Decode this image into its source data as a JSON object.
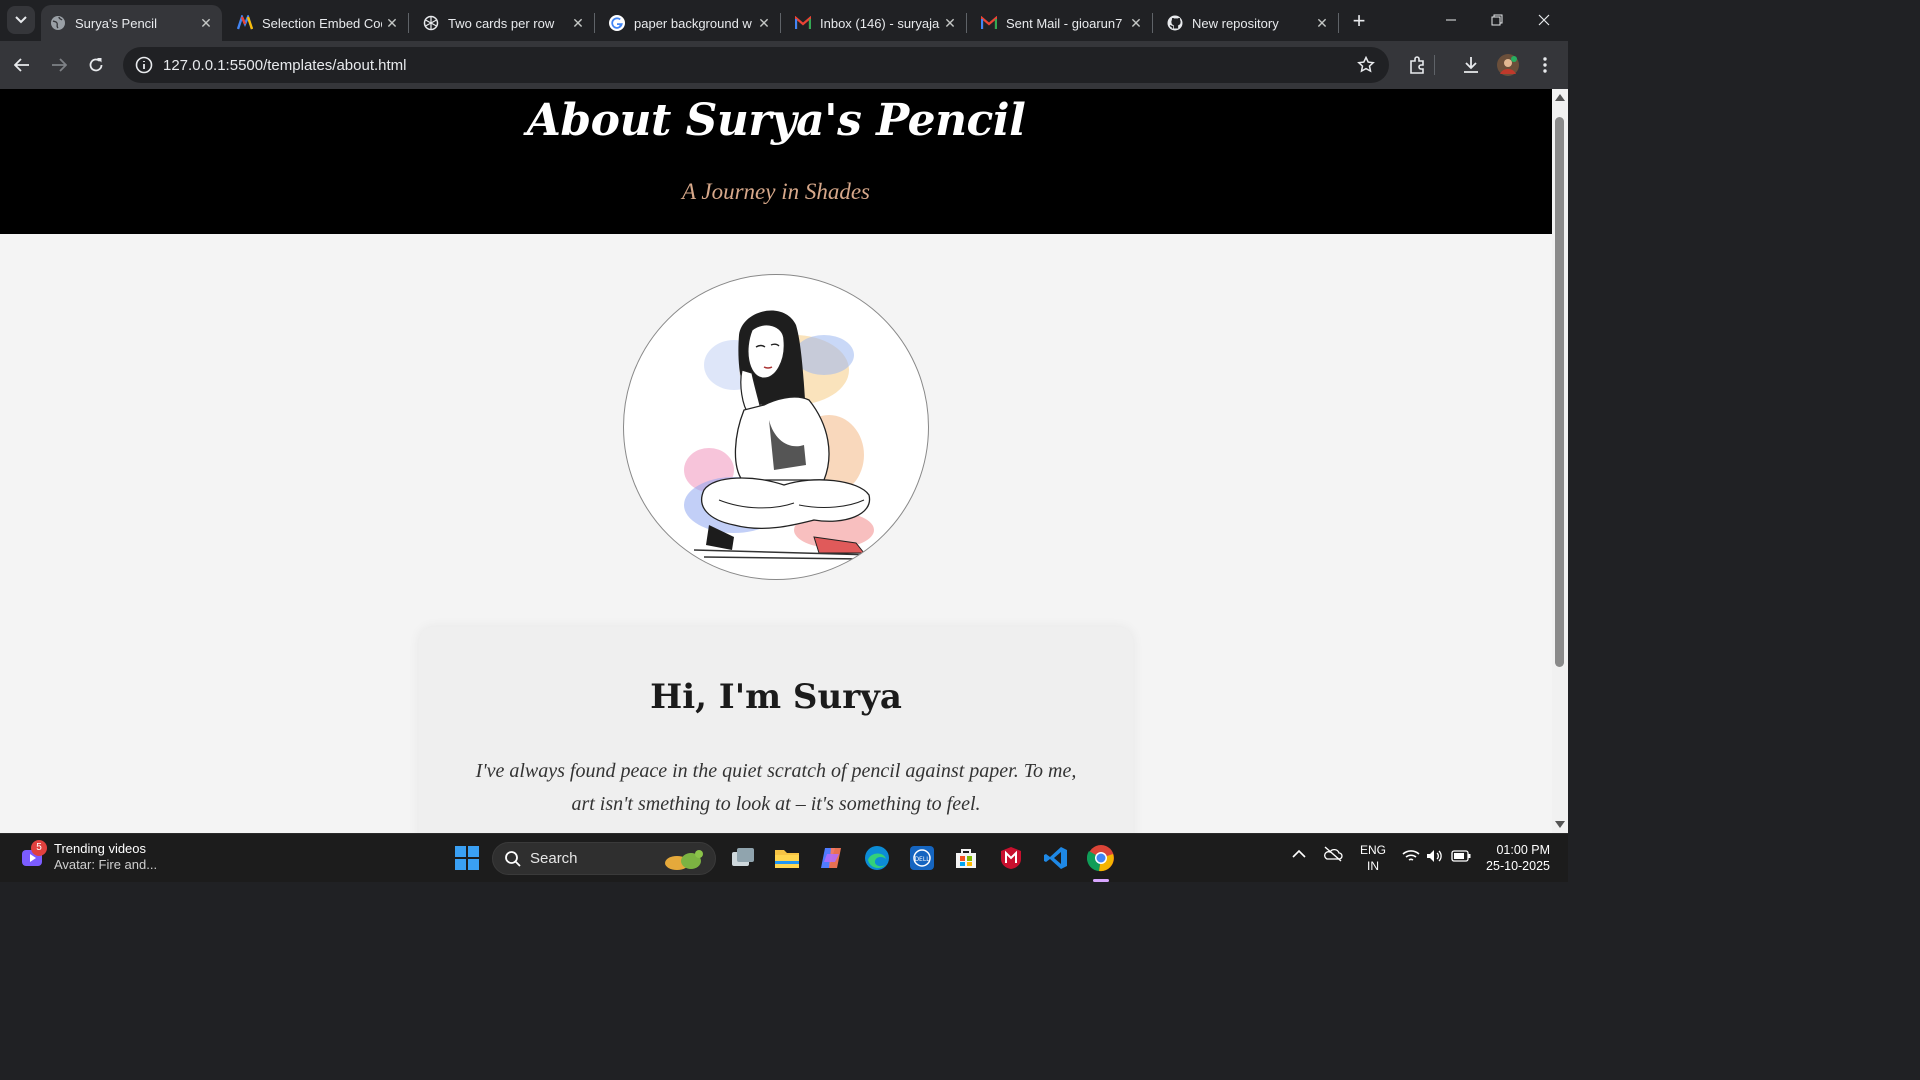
{
  "browser": {
    "tabs": [
      {
        "title": "Surya's Pencil",
        "favicon": "globe-icon",
        "active": true
      },
      {
        "title": "Selection Embed Cod",
        "favicon": "colorful-m-icon",
        "active": false
      },
      {
        "title": "Two cards per row",
        "favicon": "chatgpt-icon",
        "active": false
      },
      {
        "title": "paper background w",
        "favicon": "google-icon",
        "active": false
      },
      {
        "title": "Inbox (146) - suryaja",
        "favicon": "gmail-icon",
        "active": false
      },
      {
        "title": "Sent Mail - gioarun7",
        "favicon": "gmail-icon",
        "active": false
      },
      {
        "title": "New repository",
        "favicon": "github-icon",
        "active": false
      }
    ],
    "url": "127.0.0.1:5500/templates/about.html"
  },
  "page": {
    "hero_title": "About Surya's Pencil",
    "hero_tagline": "A Journey in Shades",
    "portrait_alt": "pencil sketch of a girl sitting cross-legged with watercolor splashes",
    "intro_heading": "Hi, I'm Surya",
    "intro_text": "I've always found peace in the quiet scratch of pencil against paper. To me, art isn't smething to look at – it's something to feel.",
    "colors": {
      "hero_bg": "#000000",
      "tagline": "#d7a88a",
      "page_bg": "#f4f4f4"
    }
  },
  "taskbar": {
    "widget_badge": "5",
    "widget_title": "Trending videos",
    "widget_sub": "Avatar: Fire and...",
    "search_label": "Search",
    "lang_top": "ENG",
    "lang_bottom": "IN",
    "time": "01:00 PM",
    "date": "25-10-2025"
  }
}
